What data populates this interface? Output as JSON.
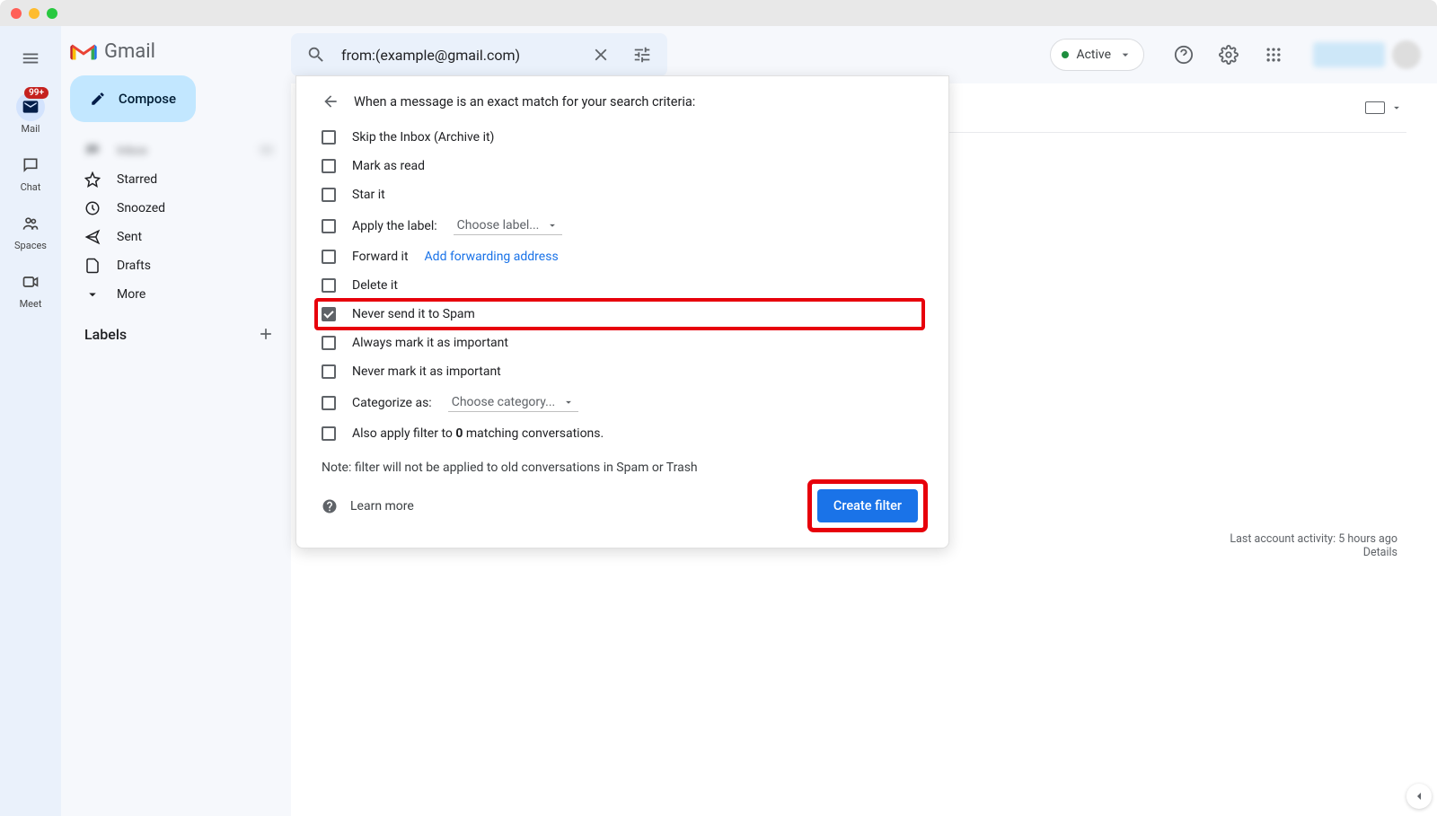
{
  "rail": {
    "mail": "Mail",
    "mail_badge": "99+",
    "chat": "Chat",
    "spaces": "Spaces",
    "meet": "Meet"
  },
  "sidebar": {
    "logo": "Gmail",
    "compose": "Compose",
    "starred": "Starred",
    "snoozed": "Snoozed",
    "sent": "Sent",
    "drafts": "Drafts",
    "more": "More",
    "labels": "Labels"
  },
  "header": {
    "search_value": "from:(example@gmail.com)",
    "status": "Active"
  },
  "filter": {
    "title": "When a message is an exact match for your search criteria:",
    "skip_inbox": "Skip the Inbox (Archive it)",
    "mark_read": "Mark as read",
    "star_it": "Star it",
    "apply_label": "Apply the label:",
    "choose_label": "Choose label...",
    "forward_it": "Forward it",
    "add_forward": "Add forwarding address",
    "delete_it": "Delete it",
    "never_spam": "Never send it to Spam",
    "always_important": "Always mark it as important",
    "never_important": "Never mark it as important",
    "categorize_as": "Categorize as:",
    "choose_category": "Choose category...",
    "also_apply_pre": "Also apply filter to ",
    "also_apply_count": "0",
    "also_apply_post": " matching conversations.",
    "note": "Note: filter will not be applied to old conversations in Spam or Trash",
    "learn_more": "Learn more",
    "create": "Create filter"
  },
  "footer": {
    "activity": "Last account activity: 5 hours ago",
    "details": "Details"
  }
}
